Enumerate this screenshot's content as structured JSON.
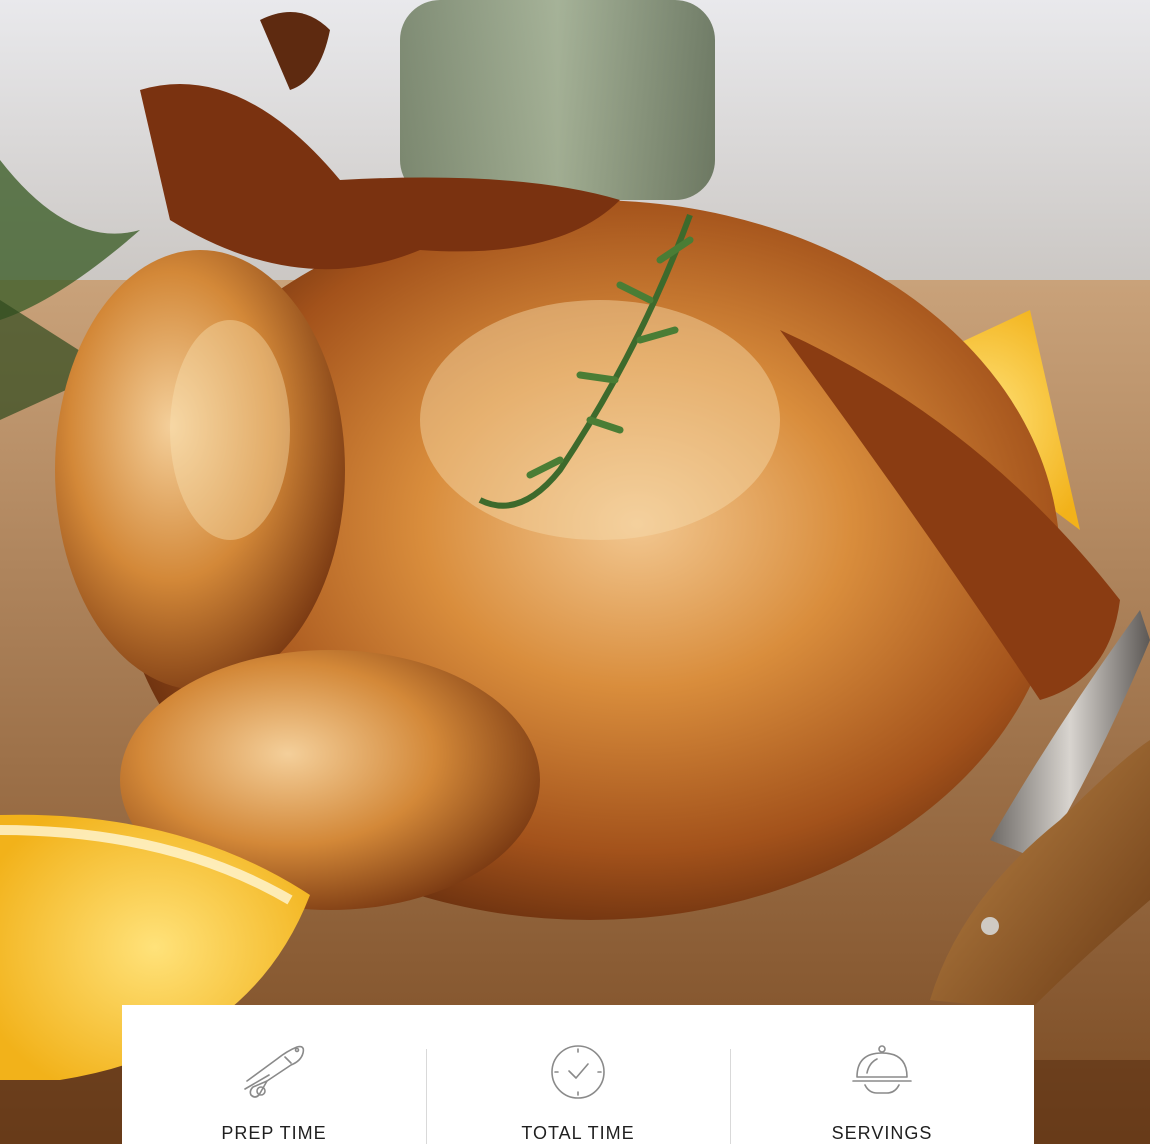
{
  "photo": {
    "subject-icon": "roast-chicken-photo"
  },
  "stats": {
    "items": [
      {
        "icon": "knife-cutting-icon",
        "label": "PREP TIME"
      },
      {
        "icon": "clock-icon",
        "label": "TOTAL TIME"
      },
      {
        "icon": "cloche-serving-icon",
        "label": "SERVINGS"
      }
    ]
  },
  "colors": {
    "card_background": "#ffffff",
    "icon_stroke": "#8a8a8a",
    "label_text": "#1f1f1f",
    "divider": "#d9d9d9"
  }
}
